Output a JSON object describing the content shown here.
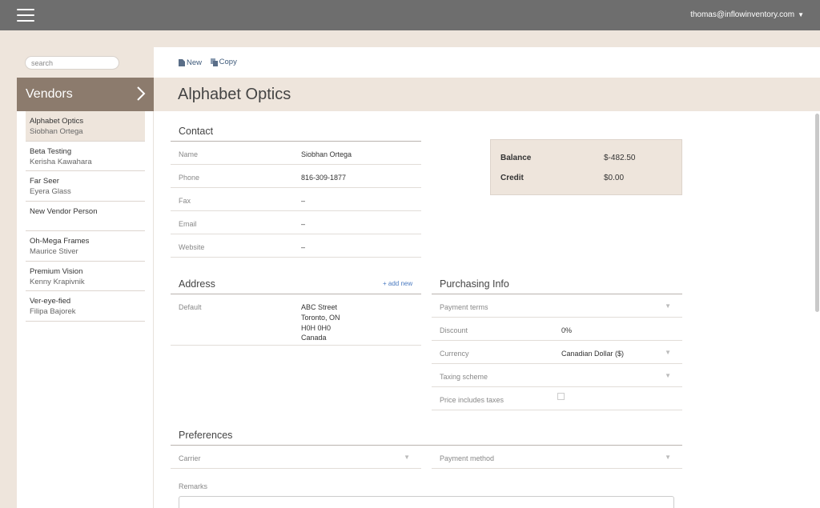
{
  "header": {
    "user_email": "thomas@inflowinventory.com",
    "caret": "▼"
  },
  "sidebar": {
    "search_placeholder": "search",
    "title": "Vendors",
    "vendors": [
      {
        "name": "Alphabet Optics",
        "contact": "Siobhan Ortega"
      },
      {
        "name": "Beta Testing",
        "contact": "Kerisha Kawahara"
      },
      {
        "name": "Far Seer",
        "contact": "Eyera Glass"
      },
      {
        "name": "New Vendor Person",
        "contact": ""
      },
      {
        "name": "Oh-Mega Frames",
        "contact": "Maurice Stiver"
      },
      {
        "name": "Premium Vision",
        "contact": "Kenny Krapivnik"
      },
      {
        "name": "Ver-eye-fied",
        "contact": "Filipa Bajorek"
      }
    ]
  },
  "toolbar": {
    "new_label": "New",
    "copy_label": "Copy"
  },
  "page": {
    "title": "Alphabet Optics"
  },
  "contact": {
    "section_title": "Contact",
    "name_label": "Name",
    "name_value": "Siobhan Ortega",
    "phone_label": "Phone",
    "phone_value": "816-309-1877",
    "fax_label": "Fax",
    "fax_value": "–",
    "email_label": "Email",
    "email_value": "–",
    "website_label": "Website",
    "website_value": "–"
  },
  "balance": {
    "balance_label": "Balance",
    "balance_value": "$-482.50",
    "credit_label": "Credit",
    "credit_value": "$0.00"
  },
  "address": {
    "section_title": "Address",
    "add_new": "+ add new",
    "default_label": "Default",
    "line1": "ABC Street",
    "line2": "Toronto, ON",
    "line3": "H0H 0H0",
    "line4": "Canada"
  },
  "purchasing": {
    "section_title": "Purchasing Info",
    "payment_terms_label": "Payment terms",
    "discount_label": "Discount",
    "discount_value": "0%",
    "currency_label": "Currency",
    "currency_value": "Canadian Dollar ($)",
    "taxing_scheme_label": "Taxing scheme",
    "price_includes_taxes_label": "Price includes taxes",
    "price_includes_taxes_checked": false
  },
  "preferences": {
    "section_title": "Preferences",
    "carrier_label": "Carrier",
    "payment_method_label": "Payment method",
    "remarks_label": "Remarks"
  },
  "icons": {
    "dropdown_arrow": "▼"
  },
  "colors": {
    "topbar": "#6e6e6e",
    "sidebar_header": "#8c7b6d",
    "band": "#eee5dc",
    "link": "#4a7ac0"
  }
}
